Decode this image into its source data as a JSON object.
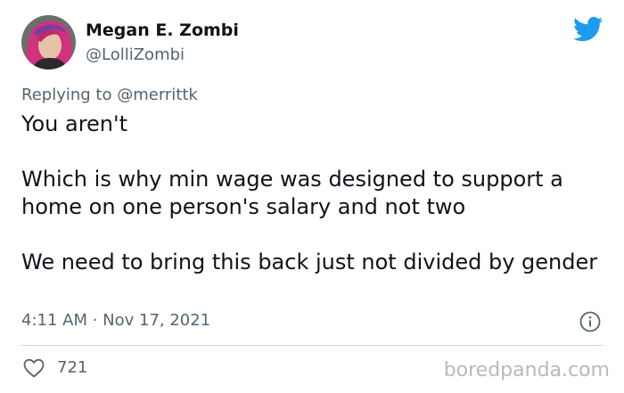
{
  "author": {
    "display_name": "Megan E. Zombi",
    "handle": "@LolliZombi"
  },
  "reply": {
    "prefix": "Replying to",
    "mention": "@merrittk"
  },
  "tweet": {
    "paragraphs": [
      "You aren't",
      "Which is why min wage was designed to support a home on one person's salary and not two",
      "We need to bring this back just not divided by gender"
    ],
    "timestamp": "4:11 AM · Nov 17, 2021"
  },
  "engagement": {
    "likes": "721"
  },
  "watermark": "boredpanda.com",
  "icons": {
    "logo": "twitter-bird-icon",
    "info": "info-icon",
    "like": "heart-icon"
  },
  "colors": {
    "twitter_blue": "#1d9bf0",
    "secondary_text": "#536471",
    "primary_text": "#0f1419",
    "divider": "#cfd9de",
    "avatar_hair": "#d1327e"
  }
}
